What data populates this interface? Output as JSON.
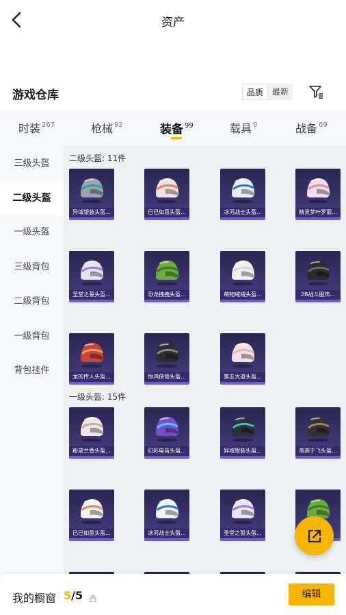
{
  "header": {
    "title": "资产",
    "back_icon": "chevron-left-icon"
  },
  "warehouse": {
    "title": "游戏仓库",
    "sort_options": [
      "品质",
      "最新"
    ],
    "active_sort": "品质",
    "filter_icon": "filter-icon"
  },
  "tabs": [
    {
      "label": "时装",
      "count": "267"
    },
    {
      "label": "枪械",
      "count": "92"
    },
    {
      "label": "装备",
      "count": "99"
    },
    {
      "label": "载具",
      "count": "0"
    },
    {
      "label": "战备",
      "count": "69"
    }
  ],
  "active_tab": "装备",
  "subnav": [
    "三级头盔",
    "二级头盔",
    "一级头盔",
    "三级背包",
    "二级背包",
    "一级背包",
    "背包挂件"
  ],
  "active_subnav": "二级头盔",
  "groups": [
    {
      "title": "二级头盔: 11件",
      "items": [
        {
          "label": "异域银装头盔...",
          "color": "#9aa7b0",
          "accent": "#2fa3a3"
        },
        {
          "label": "已已如意头盔...",
          "color": "#f0e3dc",
          "accent": "#e07b6a"
        },
        {
          "label": "冰河战士头盔...",
          "color": "#e8eef5",
          "accent": "#2f6fd6"
        },
        {
          "label": "精灵梦叶罗丽...",
          "color": "#f3dde6",
          "accent": "#d08fb0"
        },
        {
          "label": "圣堂之誓头盔...",
          "color": "#e7e2f2",
          "accent": "#9a7ed6"
        },
        {
          "label": "恐龙拽拽头盔...",
          "color": "#6cab3e",
          "accent": "#3b7a24"
        },
        {
          "label": "萌物绒绒头盔...",
          "color": "#f2f2f2",
          "accent": "#d9d9d9"
        },
        {
          "label": "2B战斗服饰...",
          "color": "#2b2b2b",
          "accent": "#6a6a6a"
        },
        {
          "label": "龙的传人头盔...",
          "color": "#c9443c",
          "accent": "#e3a846"
        },
        {
          "label": "恒鸿侠骨头盔...",
          "color": "#2d2d2d",
          "accent": "#8a8a8a"
        },
        {
          "label": "第五大道头盔...",
          "color": "#f4e1e4",
          "accent": "#e3b4bc"
        }
      ]
    },
    {
      "title": "一级头盔: 15件",
      "items": [
        {
          "label": "粉黛兰香头盔...",
          "color": "#f2e7e7",
          "accent": "#c9a7a7"
        },
        {
          "label": "幻彩电音头盔...",
          "color": "#7a4fcf",
          "accent": "#3ad0e8"
        },
        {
          "label": "异域银装头盔...",
          "color": "#2b3238",
          "accent": "#38c5c5"
        },
        {
          "label": "燕燕于飞头盔...",
          "color": "#3a2f2f",
          "accent": "#a3826a"
        },
        {
          "label": "已已如意头盔...",
          "color": "#f6f0ea",
          "accent": "#e9866e"
        },
        {
          "label": "冰河战士头盔...",
          "color": "#eef3f8",
          "accent": "#2f6fd6"
        },
        {
          "label": "圣堂之誓头盔...",
          "color": "#ece6f4",
          "accent": "#9a7ed6"
        },
        {
          "label": "",
          "color": "#6cab3e",
          "accent": "#3b7a24"
        }
      ]
    }
  ],
  "share_icon": "external-link-icon",
  "footer": {
    "label": "我的橱窗",
    "count_current": "5",
    "count_total": "/5",
    "lock_icon": "lock-icon",
    "edit_label": "编辑"
  }
}
